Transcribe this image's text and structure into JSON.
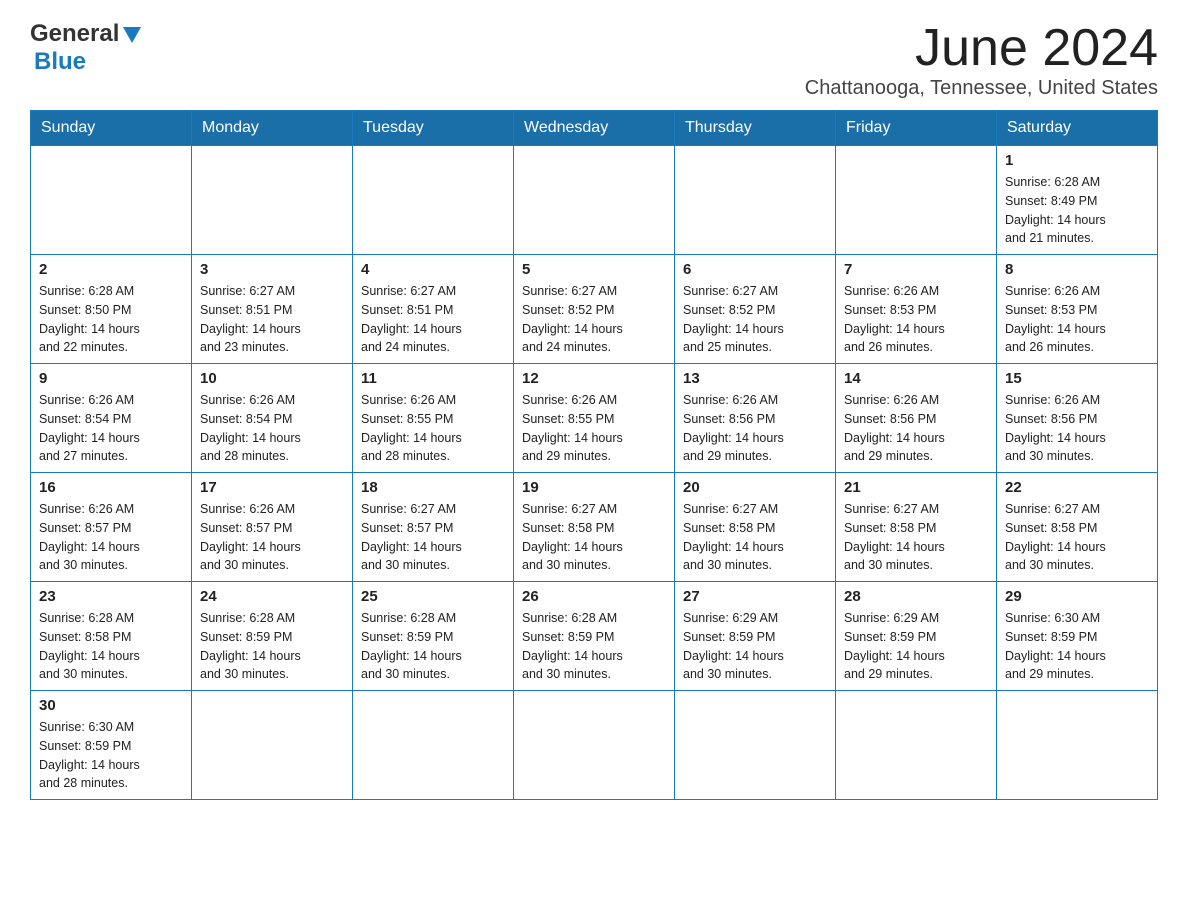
{
  "header": {
    "logo_general": "General",
    "logo_blue": "Blue",
    "title": "June 2024",
    "subtitle": "Chattanooga, Tennessee, United States"
  },
  "days_of_week": [
    "Sunday",
    "Monday",
    "Tuesday",
    "Wednesday",
    "Thursday",
    "Friday",
    "Saturday"
  ],
  "weeks": [
    {
      "days": [
        {
          "num": "",
          "info": ""
        },
        {
          "num": "",
          "info": ""
        },
        {
          "num": "",
          "info": ""
        },
        {
          "num": "",
          "info": ""
        },
        {
          "num": "",
          "info": ""
        },
        {
          "num": "",
          "info": ""
        },
        {
          "num": "1",
          "info": "Sunrise: 6:28 AM\nSunset: 8:49 PM\nDaylight: 14 hours\nand 21 minutes."
        }
      ]
    },
    {
      "days": [
        {
          "num": "2",
          "info": "Sunrise: 6:28 AM\nSunset: 8:50 PM\nDaylight: 14 hours\nand 22 minutes."
        },
        {
          "num": "3",
          "info": "Sunrise: 6:27 AM\nSunset: 8:51 PM\nDaylight: 14 hours\nand 23 minutes."
        },
        {
          "num": "4",
          "info": "Sunrise: 6:27 AM\nSunset: 8:51 PM\nDaylight: 14 hours\nand 24 minutes."
        },
        {
          "num": "5",
          "info": "Sunrise: 6:27 AM\nSunset: 8:52 PM\nDaylight: 14 hours\nand 24 minutes."
        },
        {
          "num": "6",
          "info": "Sunrise: 6:27 AM\nSunset: 8:52 PM\nDaylight: 14 hours\nand 25 minutes."
        },
        {
          "num": "7",
          "info": "Sunrise: 6:26 AM\nSunset: 8:53 PM\nDaylight: 14 hours\nand 26 minutes."
        },
        {
          "num": "8",
          "info": "Sunrise: 6:26 AM\nSunset: 8:53 PM\nDaylight: 14 hours\nand 26 minutes."
        }
      ]
    },
    {
      "days": [
        {
          "num": "9",
          "info": "Sunrise: 6:26 AM\nSunset: 8:54 PM\nDaylight: 14 hours\nand 27 minutes."
        },
        {
          "num": "10",
          "info": "Sunrise: 6:26 AM\nSunset: 8:54 PM\nDaylight: 14 hours\nand 28 minutes."
        },
        {
          "num": "11",
          "info": "Sunrise: 6:26 AM\nSunset: 8:55 PM\nDaylight: 14 hours\nand 28 minutes."
        },
        {
          "num": "12",
          "info": "Sunrise: 6:26 AM\nSunset: 8:55 PM\nDaylight: 14 hours\nand 29 minutes."
        },
        {
          "num": "13",
          "info": "Sunrise: 6:26 AM\nSunset: 8:56 PM\nDaylight: 14 hours\nand 29 minutes."
        },
        {
          "num": "14",
          "info": "Sunrise: 6:26 AM\nSunset: 8:56 PM\nDaylight: 14 hours\nand 29 minutes."
        },
        {
          "num": "15",
          "info": "Sunrise: 6:26 AM\nSunset: 8:56 PM\nDaylight: 14 hours\nand 30 minutes."
        }
      ]
    },
    {
      "days": [
        {
          "num": "16",
          "info": "Sunrise: 6:26 AM\nSunset: 8:57 PM\nDaylight: 14 hours\nand 30 minutes."
        },
        {
          "num": "17",
          "info": "Sunrise: 6:26 AM\nSunset: 8:57 PM\nDaylight: 14 hours\nand 30 minutes."
        },
        {
          "num": "18",
          "info": "Sunrise: 6:27 AM\nSunset: 8:57 PM\nDaylight: 14 hours\nand 30 minutes."
        },
        {
          "num": "19",
          "info": "Sunrise: 6:27 AM\nSunset: 8:58 PM\nDaylight: 14 hours\nand 30 minutes."
        },
        {
          "num": "20",
          "info": "Sunrise: 6:27 AM\nSunset: 8:58 PM\nDaylight: 14 hours\nand 30 minutes."
        },
        {
          "num": "21",
          "info": "Sunrise: 6:27 AM\nSunset: 8:58 PM\nDaylight: 14 hours\nand 30 minutes."
        },
        {
          "num": "22",
          "info": "Sunrise: 6:27 AM\nSunset: 8:58 PM\nDaylight: 14 hours\nand 30 minutes."
        }
      ]
    },
    {
      "days": [
        {
          "num": "23",
          "info": "Sunrise: 6:28 AM\nSunset: 8:58 PM\nDaylight: 14 hours\nand 30 minutes."
        },
        {
          "num": "24",
          "info": "Sunrise: 6:28 AM\nSunset: 8:59 PM\nDaylight: 14 hours\nand 30 minutes."
        },
        {
          "num": "25",
          "info": "Sunrise: 6:28 AM\nSunset: 8:59 PM\nDaylight: 14 hours\nand 30 minutes."
        },
        {
          "num": "26",
          "info": "Sunrise: 6:28 AM\nSunset: 8:59 PM\nDaylight: 14 hours\nand 30 minutes."
        },
        {
          "num": "27",
          "info": "Sunrise: 6:29 AM\nSunset: 8:59 PM\nDaylight: 14 hours\nand 30 minutes."
        },
        {
          "num": "28",
          "info": "Sunrise: 6:29 AM\nSunset: 8:59 PM\nDaylight: 14 hours\nand 29 minutes."
        },
        {
          "num": "29",
          "info": "Sunrise: 6:30 AM\nSunset: 8:59 PM\nDaylight: 14 hours\nand 29 minutes."
        }
      ]
    },
    {
      "days": [
        {
          "num": "30",
          "info": "Sunrise: 6:30 AM\nSunset: 8:59 PM\nDaylight: 14 hours\nand 28 minutes."
        },
        {
          "num": "",
          "info": ""
        },
        {
          "num": "",
          "info": ""
        },
        {
          "num": "",
          "info": ""
        },
        {
          "num": "",
          "info": ""
        },
        {
          "num": "",
          "info": ""
        },
        {
          "num": "",
          "info": ""
        }
      ]
    }
  ]
}
